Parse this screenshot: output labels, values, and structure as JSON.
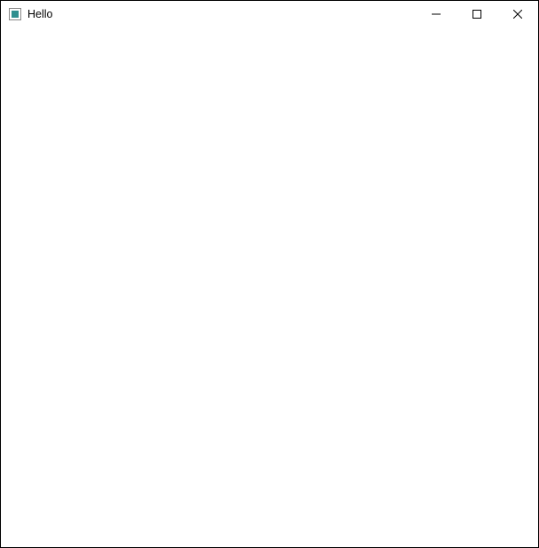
{
  "window": {
    "title": "Hello"
  }
}
